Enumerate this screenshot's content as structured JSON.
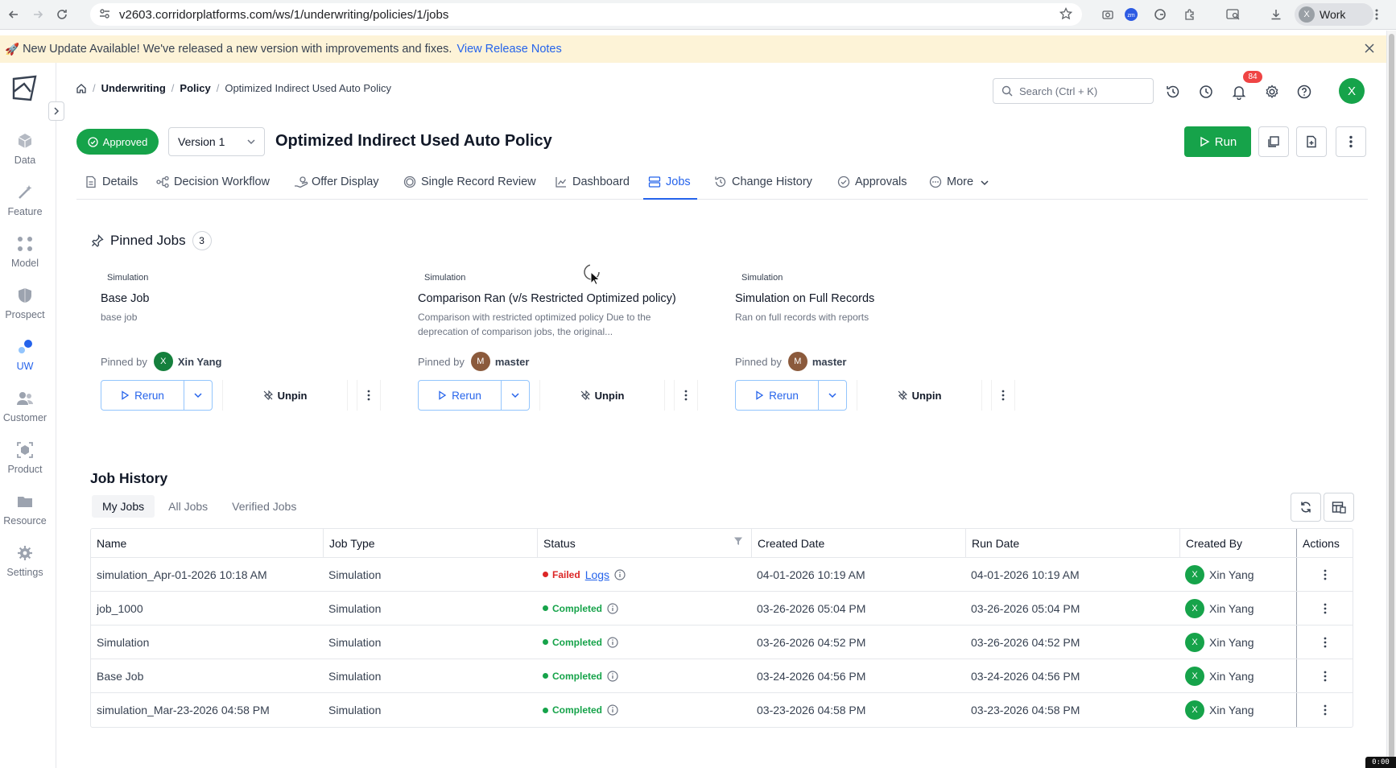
{
  "browser": {
    "url": "v2603.corridorplatforms.com/ws/1/underwriting/policies/1/jobs",
    "profile_label": "Work",
    "profile_initial": "X"
  },
  "banner": {
    "icon": "rocket-icon",
    "message": "New Update Available! We've released a new version with improvements and fixes.",
    "link": "View Release Notes"
  },
  "sidebar": {
    "items": [
      {
        "label": "Data",
        "icon": "cube-icon",
        "active": false
      },
      {
        "label": "Feature",
        "icon": "wand-icon",
        "active": false
      },
      {
        "label": "Model",
        "icon": "grid-icon",
        "active": false
      },
      {
        "label": "Prospect",
        "icon": "shield-icon",
        "active": false
      },
      {
        "label": "UW",
        "icon": "uw-icon",
        "active": true
      },
      {
        "label": "Customer",
        "icon": "users-icon",
        "active": false
      },
      {
        "label": "Product",
        "icon": "product-icon",
        "active": false
      },
      {
        "label": "Resource",
        "icon": "folder-icon",
        "active": false
      },
      {
        "label": "Settings",
        "icon": "gear-icon",
        "active": false
      }
    ]
  },
  "header": {
    "breadcrumb": [
      "Underwriting",
      "Policy",
      "Optimized Indirect Used Auto Policy"
    ],
    "search_placeholder": "Search (Ctrl + K)",
    "notification_count": "84",
    "user_initial": "X"
  },
  "policy": {
    "status": "Approved",
    "version": "Version 1",
    "title": "Optimized Indirect Used Auto Policy",
    "run_label": "Run"
  },
  "tabs": [
    {
      "label": "Details",
      "icon": "document-icon"
    },
    {
      "label": "Decision Workflow",
      "icon": "workflow-icon"
    },
    {
      "label": "Offer Display",
      "icon": "offer-icon"
    },
    {
      "label": "Single Record Review",
      "icon": "target-icon"
    },
    {
      "label": "Dashboard",
      "icon": "chart-icon"
    },
    {
      "label": "Jobs",
      "icon": "stack-icon",
      "active": true
    },
    {
      "label": "Change History",
      "icon": "history-icon"
    },
    {
      "label": "Approvals",
      "icon": "check-circle-icon"
    },
    {
      "label": "More",
      "icon": "more-circle-icon"
    }
  ],
  "pinned": {
    "title": "Pinned Jobs",
    "count": "3",
    "pinned_by_label": "Pinned by",
    "rerun_label": "Rerun",
    "unpin_label": "Unpin",
    "jobs": [
      {
        "type": "Simulation",
        "name": "Base Job",
        "description": "base job",
        "pinned_by": "Xin Yang",
        "avatar": "X",
        "avatar_color": "#15803d"
      },
      {
        "type": "Simulation",
        "name": "Comparison Ran (v/s Restricted Optimized policy)",
        "description": "Comparison with restricted optimized policy Due to the deprecation of comparison jobs, the original...",
        "pinned_by": "master",
        "avatar": "M",
        "avatar_color": "#8b5a3c"
      },
      {
        "type": "Simulation",
        "name": "Simulation on Full Records",
        "description": "Ran on full records with reports",
        "pinned_by": "master",
        "avatar": "M",
        "avatar_color": "#8b5a3c"
      }
    ]
  },
  "history": {
    "title": "Job History",
    "tabs": [
      "My Jobs",
      "All Jobs",
      "Verified Jobs"
    ],
    "active_tab": "My Jobs",
    "columns": [
      "Name",
      "Job Type",
      "Status",
      "Created Date",
      "Run Date",
      "Created By",
      "Actions"
    ],
    "logs_label": "Logs",
    "rows": [
      {
        "name": "simulation_Apr-01-2026 10:18 AM",
        "type": "Simulation",
        "status": "Failed",
        "status_color": "#dc2626",
        "logs": true,
        "created": "04-01-2026 10:19 AM",
        "run": "04-01-2026 10:19 AM",
        "by": "Xin Yang",
        "by_initial": "X"
      },
      {
        "name": "job_1000",
        "type": "Simulation",
        "status": "Completed",
        "status_color": "#16a34a",
        "logs": false,
        "created": "03-26-2026 05:04 PM",
        "run": "03-26-2026 05:04 PM",
        "by": "Xin Yang",
        "by_initial": "X"
      },
      {
        "name": "Simulation",
        "type": "Simulation",
        "status": "Completed",
        "status_color": "#16a34a",
        "logs": false,
        "created": "03-26-2026 04:52 PM",
        "run": "03-26-2026 04:52 PM",
        "by": "Xin Yang",
        "by_initial": "X"
      },
      {
        "name": "Base Job",
        "type": "Simulation",
        "status": "Completed",
        "status_color": "#16a34a",
        "logs": false,
        "created": "03-24-2026 04:56 PM",
        "run": "03-24-2026 04:56 PM",
        "by": "Xin Yang",
        "by_initial": "X"
      },
      {
        "name": "simulation_Mar-23-2026 04:58 PM",
        "type": "Simulation",
        "status": "Completed",
        "status_color": "#16a34a",
        "logs": false,
        "created": "03-23-2026 04:58 PM",
        "run": "03-23-2026 04:58 PM",
        "by": "Xin Yang",
        "by_initial": "X"
      }
    ]
  },
  "recording_timer": "0:00"
}
